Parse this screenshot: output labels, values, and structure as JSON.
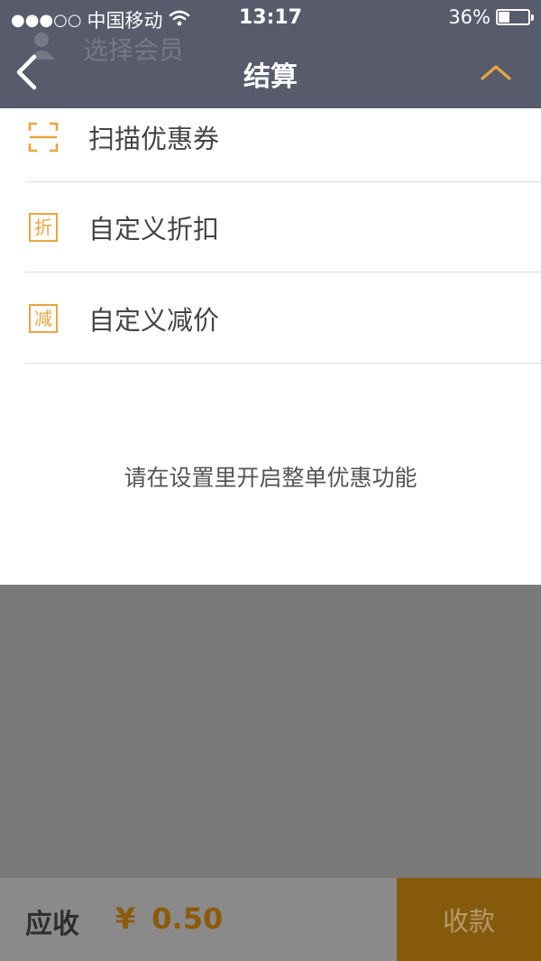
{
  "status_bar": {
    "signal": "●●●○○",
    "carrier": "中国移动",
    "time": "13:17",
    "battery_text": "36%",
    "battery_level": 0.36
  },
  "nav": {
    "title": "结算",
    "member_hint": "选择会员"
  },
  "menu": {
    "items": [
      {
        "label": "扫描优惠券",
        "icon": "scan-icon"
      },
      {
        "label": "自定义折扣",
        "icon": "discount-icon",
        "icon_char": "折"
      },
      {
        "label": "自定义减价",
        "icon": "reduce-price-icon",
        "icon_char": "减"
      }
    ]
  },
  "notice": "请在设置里开启整单优惠功能",
  "footer": {
    "receivable_label": "应收",
    "currency": "¥",
    "amount": "0.50",
    "collect_label": "收款"
  },
  "colors": {
    "header_bg": "#575b6b",
    "accent_orange": "#e9a640",
    "overlay_gray": "#7a7a7a",
    "collect_button_bg": "#855a0c"
  }
}
